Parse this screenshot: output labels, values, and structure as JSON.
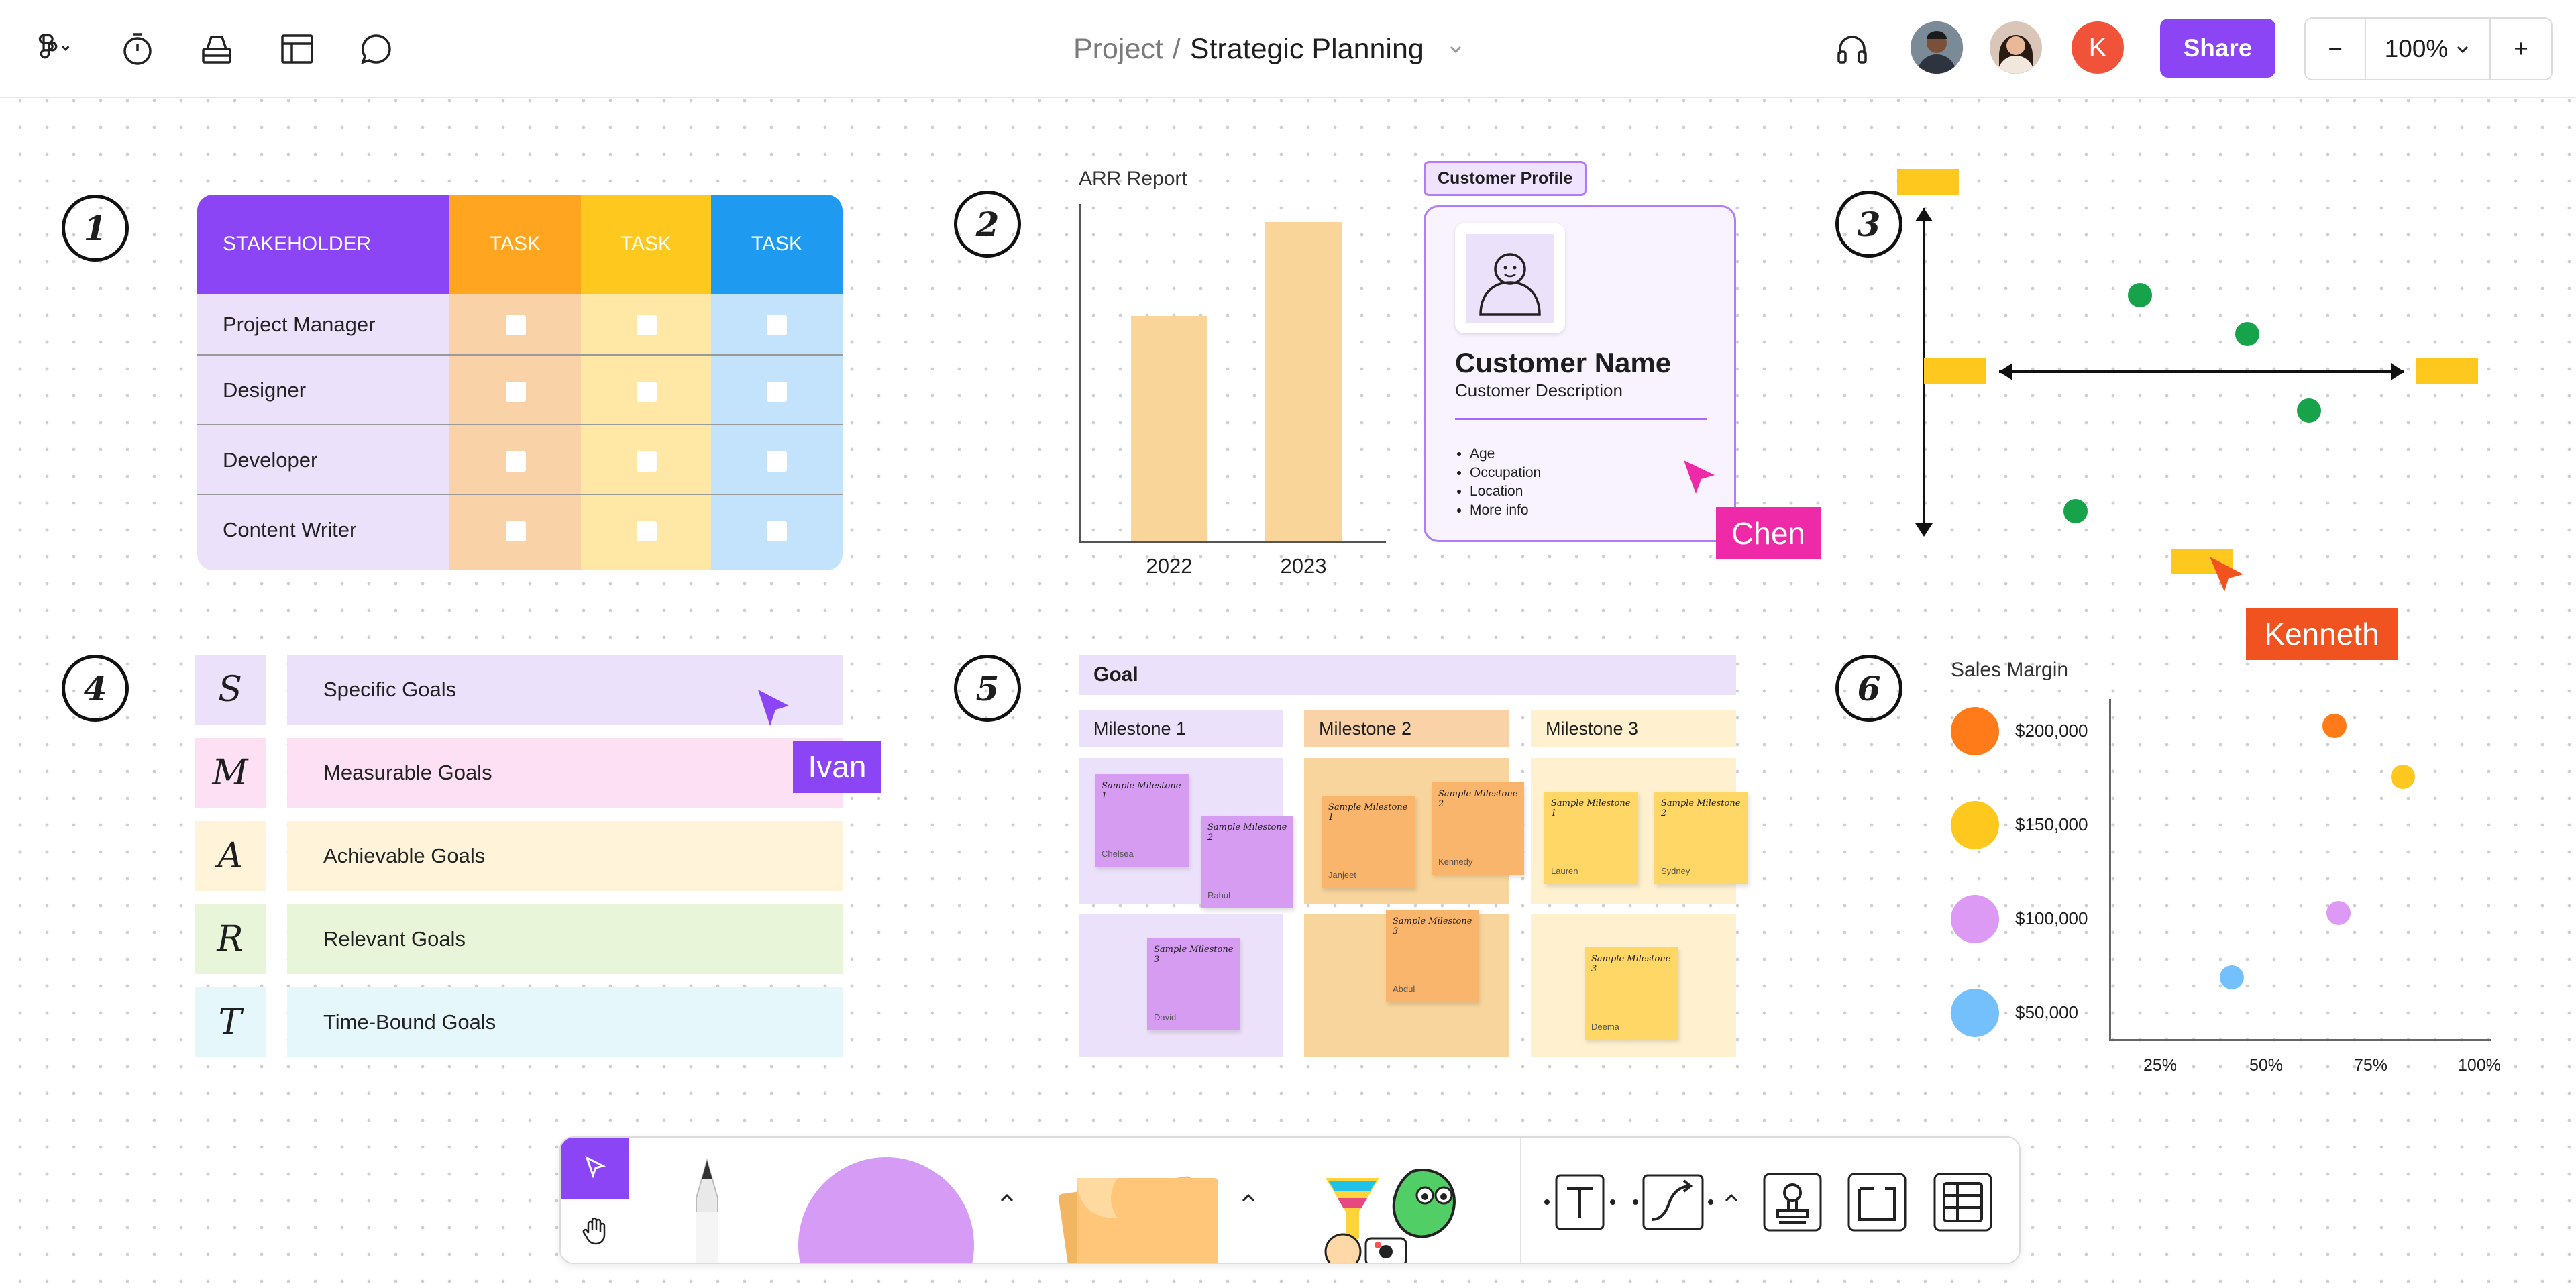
{
  "header": {
    "breadcrumb_project": "Project",
    "breadcrumb_sep": "/",
    "breadcrumb_file": "Strategic Planning",
    "share_label": "Share",
    "zoom_level": "100%",
    "zoom_minus": "−",
    "zoom_plus": "+",
    "avatar_k": "K"
  },
  "sections": {
    "s1": "1",
    "s2": "2",
    "s3": "3",
    "s4": "4",
    "s5": "5",
    "s6": "6"
  },
  "stakeholder": {
    "header": "STAKEHOLDER",
    "tasks": [
      "TASK",
      "TASK",
      "TASK"
    ],
    "rows": [
      "Project Manager",
      "Designer",
      "Developer",
      "Content Writer"
    ],
    "colors": {
      "purple": "#8b45f5",
      "orange": "#ffa51f",
      "yellow": "#ffc81f",
      "blue": "#1e9bf0"
    }
  },
  "arr": {
    "title": "ARR Report",
    "bars": [
      {
        "label": "2022",
        "value": 0.67
      },
      {
        "label": "2023",
        "value": 0.95
      }
    ],
    "color": "#f9d59a"
  },
  "profile": {
    "tag": "Customer Profile",
    "name": "Customer Name",
    "description": "Customer Description",
    "bullets": [
      "Age",
      "Occupation",
      "Location",
      "More info"
    ]
  },
  "smart": {
    "letters": [
      "S",
      "M",
      "A",
      "R",
      "T"
    ],
    "labels": [
      "Specific Goals",
      "Measurable Goals",
      "Achievable Goals",
      "Relevant Goals",
      "Time-Bound Goals"
    ]
  },
  "goal": {
    "title": "Goal",
    "milestones": [
      "Milestone 1",
      "Milestone 2",
      "Milestone 3"
    ],
    "sticky_title_1": "Sample Milestone 1",
    "sticky_title_2": "Sample Milestone 2",
    "sticky_title_3": "Sample Milestone 3",
    "people": [
      "Chelsea",
      "Rahul",
      "David",
      "Janjeet",
      "Kennedy",
      "Abdul",
      "Lauren",
      "Sydney",
      "Deema"
    ]
  },
  "cursors": {
    "chen": "Chen",
    "kenneth": "Kenneth",
    "ivan": "Ivan"
  },
  "chart_data": {
    "type": "scatter",
    "title": "Sales Margin",
    "legend": [
      {
        "label": "$200,000",
        "color": "#ff7a18"
      },
      {
        "label": "$150,000",
        "color": "#ffc81f"
      },
      {
        "label": "$100,000",
        "color": "#dc9af5"
      },
      {
        "label": "$50,000",
        "color": "#74c0fc"
      }
    ],
    "x_ticks": [
      "25%",
      "50%",
      "75%",
      "100%"
    ],
    "points": [
      {
        "series": "$200,000",
        "x": 0.59,
        "y": 0.92
      },
      {
        "series": "$150,000",
        "x": 0.77,
        "y": 0.77
      },
      {
        "series": "$100,000",
        "x": 0.6,
        "y": 0.37
      },
      {
        "series": "$50,000",
        "x": 0.32,
        "y": 0.18
      }
    ]
  }
}
